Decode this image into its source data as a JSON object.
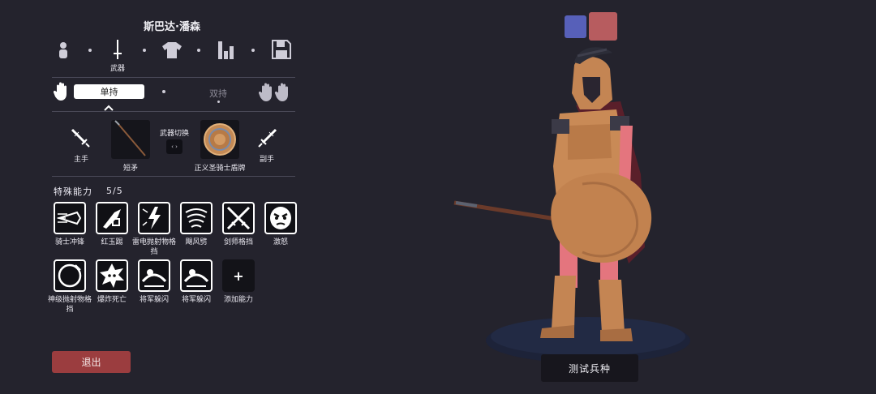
{
  "unit_name": "斯巴达·潘森",
  "nav": {
    "items": [
      {
        "icon": "unit-figure-icon",
        "label": ""
      },
      {
        "icon": "sword-icon",
        "label": "武器"
      },
      {
        "icon": "armor-shirt-icon",
        "label": ""
      },
      {
        "icon": "stats-bars-icon",
        "label": ""
      },
      {
        "icon": "save-floppy-icon",
        "label": ""
      }
    ]
  },
  "grip": {
    "single": "单持",
    "dual": "双持"
  },
  "weapons": {
    "main_hand": "主手",
    "off_hand": "副手",
    "swap": "武器切换",
    "main_weapon": "短矛",
    "off_weapon": "正义圣骑士盾牌"
  },
  "abilities": {
    "title": "特殊能力",
    "count": "5/5",
    "items": [
      {
        "label": "骑士冲锋",
        "icon": "knight-charge-icon"
      },
      {
        "label": "红玉踢",
        "icon": "ruby-kick-icon"
      },
      {
        "label": "雷电抛射物格挡",
        "icon": "lightning-block-icon"
      },
      {
        "label": "飓风劈",
        "icon": "hurricane-slash-icon"
      },
      {
        "label": "剑师格挡",
        "icon": "swordmaster-block-icon"
      },
      {
        "label": "激怒",
        "icon": "enrage-face-icon"
      },
      {
        "label": "神级抛射物格挡",
        "icon": "divine-block-icon"
      },
      {
        "label": "爆炸死亡",
        "icon": "explode-death-icon"
      },
      {
        "label": "将军躲闪",
        "icon": "general-dodge-icon"
      },
      {
        "label": "将军躲闪",
        "icon": "general-dodge-icon"
      }
    ],
    "add_label": "添加能力",
    "add_symbol": "+"
  },
  "exit_label": "退出",
  "test_label": "测试兵种",
  "colors": {
    "background": "#24232d",
    "team_blue": "#5760b9",
    "team_red": "#b75c5f",
    "exit": "#9b3d3f"
  }
}
